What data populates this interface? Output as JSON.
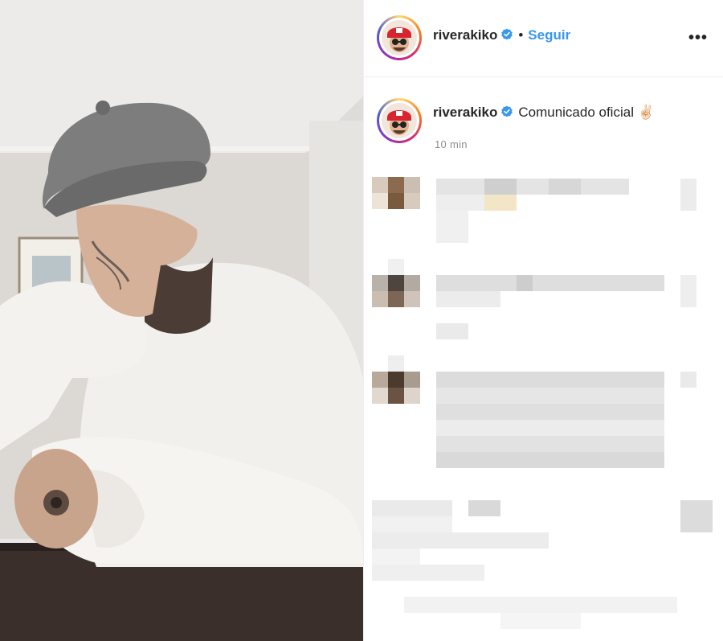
{
  "post": {
    "username": "riverakiko",
    "follow_label": "Seguir",
    "dot": "•",
    "more_label": "•••"
  },
  "caption": {
    "username": "riverakiko",
    "text": "Comunicado oficial ✌🏻",
    "time": "10 min"
  },
  "colors": {
    "follow": "#3897f0",
    "verified": "#3897f0",
    "text": "#262626",
    "muted": "#8e8e8e"
  },
  "icons": {
    "verified": "verified-badge-icon",
    "more": "more-options-icon"
  }
}
